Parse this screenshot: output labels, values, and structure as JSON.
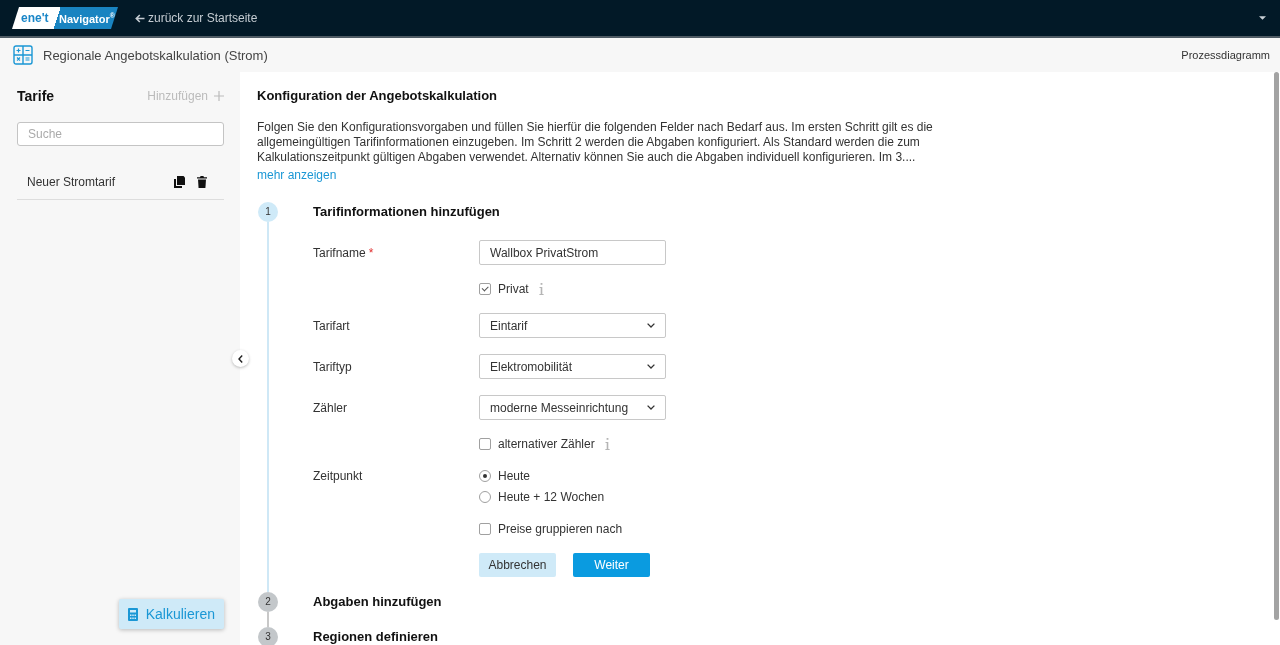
{
  "top_bar": {
    "logo": {
      "brand": "ene't",
      "product": "Navigator$^{®}$"
    },
    "back_link": "zurück zur Startseite"
  },
  "page_header": {
    "title": "Regionale Angebotskalkulation (Strom)",
    "process_link": "Prozessdiagramm"
  },
  "sidebar": {
    "title": "Tarife",
    "add_button": "Hinzufügen",
    "search": {
      "placeholder": "Suche"
    },
    "items": [
      {
        "label": "Neuer Stromtarif"
      }
    ],
    "calculate_button": "Kalkulieren"
  },
  "main": {
    "title": "Konfiguration der Angebotskalkulation",
    "intro": "Folgen Sie den Konfigurationsvorgaben und füllen Sie hierfür die folgenden Felder nach Bedarf aus. Im ersten Schritt gilt es die allgemeingültigen Tarifinformationen einzugeben. Im Schritt 2 werden die Abgaben konfiguriert. Als Standard werden die zum Kalkulationszeitpunkt gültigen Abgaben verwendet. Alternativ können Sie auch die Abgaben individuell konfigurieren. Im 3....",
    "more_link": "mehr anzeigen",
    "steps": [
      {
        "number": "1",
        "title": "Tarifinformationen hinzufügen",
        "active": true,
        "fields": [
          {
            "kind": "text",
            "label": "Tarifname",
            "required_mark": "*",
            "value": "Wallbox PrivatStrom"
          },
          {
            "kind": "checkbox",
            "label": "Privat",
            "checked": true,
            "info": true
          },
          {
            "kind": "select",
            "label": "Tarifart",
            "value": "Eintarif"
          },
          {
            "kind": "select",
            "label": "Tariftyp",
            "value": "Elektromobilität"
          },
          {
            "kind": "select",
            "label": "Zähler",
            "value": "moderne Messeinrichtung"
          },
          {
            "kind": "checkbox",
            "label": "alternativer Zähler",
            "checked": false,
            "info": true
          },
          {
            "kind": "radio",
            "label": "Zeitpunkt",
            "options": [
              {
                "label": "Heute",
                "selected": true
              },
              {
                "label": "Heute + 12 Wochen",
                "selected": false
              }
            ]
          },
          {
            "kind": "checkbox",
            "label": "Preise gruppieren nach",
            "checked": false,
            "info": false
          }
        ],
        "buttons": [
          {
            "label": "Abbrechen",
            "kind": "secondary"
          },
          {
            "label": "Weiter",
            "kind": "primary"
          }
        ]
      },
      {
        "number": "2",
        "title": "Abgaben hinzufügen",
        "active": false
      },
      {
        "number": "3",
        "title": "Regionen definieren",
        "active": false
      }
    ]
  }
}
